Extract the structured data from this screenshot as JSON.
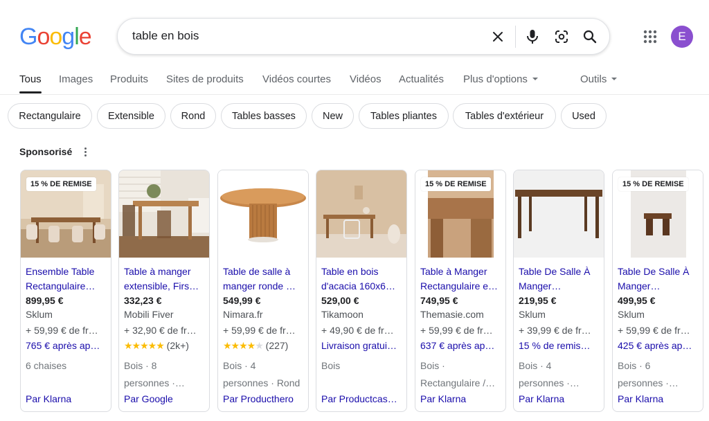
{
  "logo": {
    "letters": [
      "G",
      "o",
      "o",
      "g",
      "l",
      "e"
    ],
    "colors": [
      "#4285F4",
      "#EA4335",
      "#FBBC05",
      "#4285F4",
      "#34A853",
      "#EA4335"
    ]
  },
  "search": {
    "query": "table en bois"
  },
  "avatar": {
    "initial": "E",
    "color": "#8a4fcf"
  },
  "tabs": [
    {
      "label": "Tous",
      "active": true
    },
    {
      "label": "Images"
    },
    {
      "label": "Produits"
    },
    {
      "label": "Sites de produits"
    },
    {
      "label": "Vidéos courtes"
    },
    {
      "label": "Vidéos"
    },
    {
      "label": "Actualités"
    },
    {
      "label": "Plus d'options"
    },
    {
      "label": "Outils"
    }
  ],
  "chips": [
    "Rectangulaire",
    "Extensible",
    "Rond",
    "Tables basses",
    "New",
    "Tables pliantes",
    "Tables d'extérieur",
    "Used"
  ],
  "sponsored_label": "Sponsorisé",
  "products": [
    {
      "badge": "15 % DE REMISE",
      "title": "Ensemble Table Rectangulaire…",
      "price": "899,95 €",
      "merchant": "Sklum",
      "shipping": "+ 59,99 € de fr…",
      "line5": "765 € après ap…",
      "details": [
        "6 chaises",
        ""
      ],
      "via": "Par Klarna"
    },
    {
      "badge": "",
      "title": "Table à manger extensible, Firs…",
      "price": "332,23 €",
      "merchant": "Mobili Fiver",
      "shipping": "+ 32,90 € de fr…",
      "rating": 5,
      "reviews": "(2k+)",
      "details": [
        "Bois · 8",
        "personnes ·…"
      ],
      "via": "Par Google"
    },
    {
      "badge": "",
      "title": "Table de salle à manger ronde …",
      "price": "549,99 €",
      "merchant": "Nimara.fr",
      "shipping": "+ 59,99 € de fr…",
      "rating": 4,
      "reviews": "(227)",
      "details": [
        "Bois · 4",
        "personnes · Rond"
      ],
      "via": "Par Producthero"
    },
    {
      "badge": "",
      "title": "Table en bois d'acacia 160x6…",
      "price": "529,00 €",
      "merchant": "Tikamoon",
      "shipping": "+ 49,90 € de fr…",
      "line5": "Livraison gratui…",
      "details": [
        "Bois",
        ""
      ],
      "via": "Par Productcas…"
    },
    {
      "badge": "15 % DE REMISE",
      "title": "Table à Manger Rectangulaire e…",
      "price": "749,95 €",
      "merchant": "Themasie.com",
      "shipping": "+ 59,99 € de fr…",
      "line5": "637 € après ap…",
      "details": [
        "Bois ·",
        "Rectangulaire /…"
      ],
      "via": "Par Klarna"
    },
    {
      "badge": "",
      "title": "Table De Salle À Manger…",
      "price": "219,95 €",
      "merchant": "Sklum",
      "shipping": "+ 39,99 € de fr…",
      "line5": "15 % de remis…",
      "details": [
        "Bois · 4",
        "personnes ·…"
      ],
      "via": "Par Klarna"
    },
    {
      "badge": "15 % DE REMISE",
      "title": "Table De Salle À Manger…",
      "price": "499,95 €",
      "merchant": "Sklum",
      "shipping": "+ 59,99 € de fr…",
      "line5": "425 € après ap…",
      "details": [
        "Bois · 6",
        "personnes ·…"
      ],
      "via": "Par Klarna"
    }
  ]
}
